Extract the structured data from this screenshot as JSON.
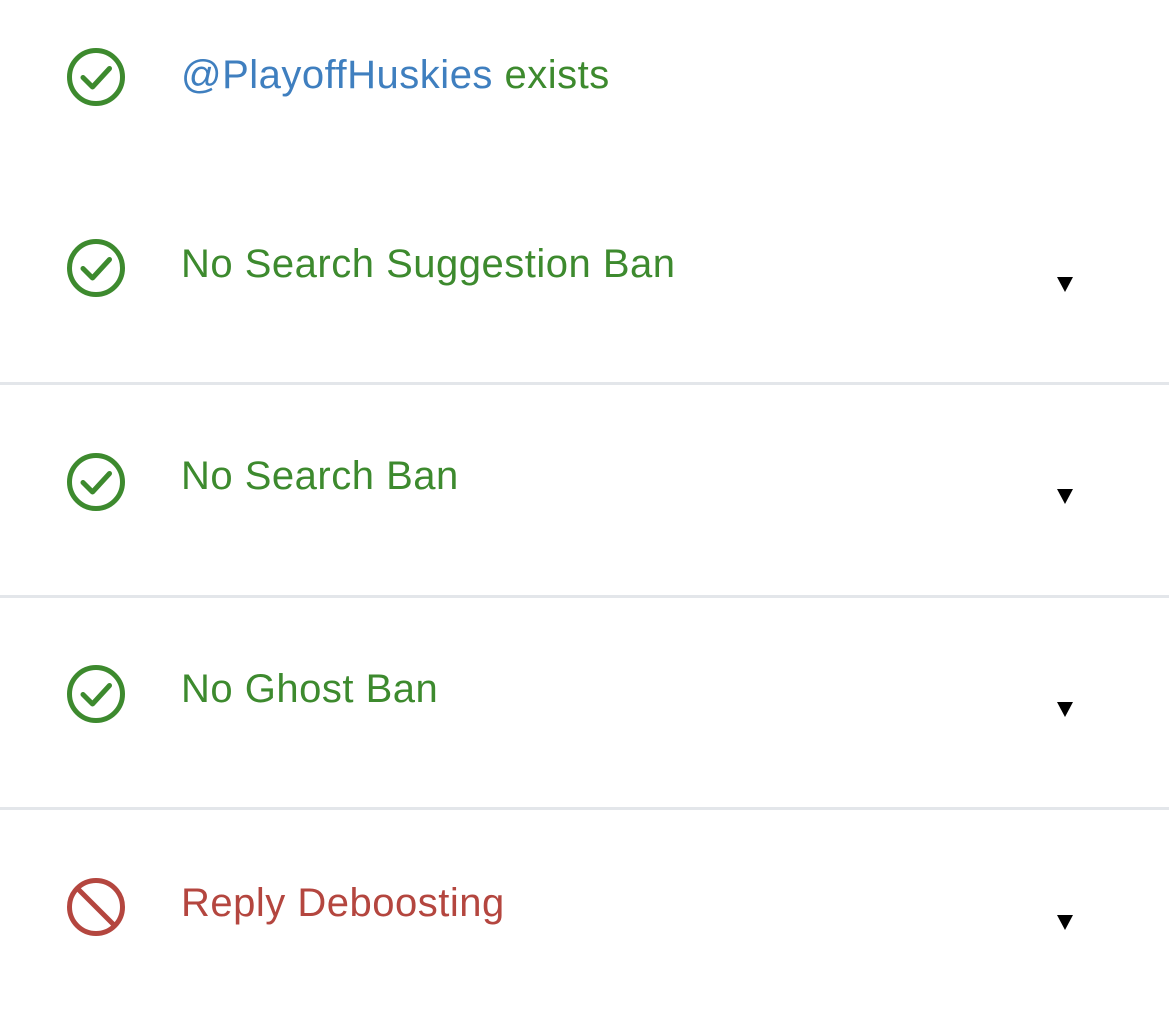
{
  "colors": {
    "success": "#3d8a2e",
    "failure": "#b4463f",
    "handle": "#3f7fbf",
    "divider": "#e3e6ea"
  },
  "header": {
    "handle": "@PlayoffHuskies",
    "suffix": " exists",
    "icon": "check-circle-icon"
  },
  "checks": [
    {
      "label": "No Search Suggestion Ban",
      "status": "pass",
      "icon": "check-circle-icon",
      "toggle": "caret-down-icon"
    },
    {
      "label": "No Search Ban",
      "status": "pass",
      "icon": "check-circle-icon",
      "toggle": "caret-down-icon"
    },
    {
      "label": "No Ghost Ban",
      "status": "pass",
      "icon": "check-circle-icon",
      "toggle": "caret-down-icon"
    },
    {
      "label": "Reply Deboosting",
      "status": "fail",
      "icon": "prohibited-icon",
      "toggle": "caret-down-icon"
    }
  ]
}
